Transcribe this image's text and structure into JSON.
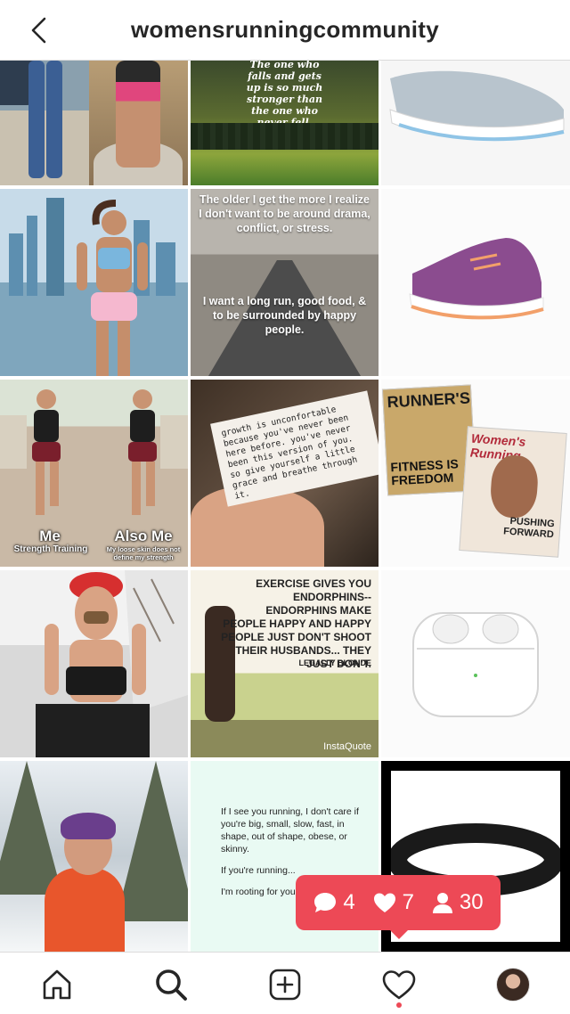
{
  "header": {
    "title": "womensrunningcommunity",
    "back_icon": "chevron-left-icon"
  },
  "tiles": {
    "quote_fall": "The one who falls and gets up is so much stronger than the one who never fell.",
    "quote_drama_top": "The older I get the more I realize I don't want to be around drama, conflict, or stress.",
    "quote_drama_bottom": "I want a long run, good food, & to be surrounded by happy people.",
    "meme_left": "Me",
    "meme_left_sub": "Strength Training",
    "meme_right": "Also Me",
    "meme_right_sub": "My loose skin does not define my strength",
    "paper_note": "growth is unconfortable because you've never been here before. you've never been this version of you. so give yourself a little grace and breathe through it.",
    "magazine_title": "RUNNER'S",
    "magazine_cover_line": "FITNESS IS FREEDOM",
    "magazine2_title": "Women's Running",
    "magazine2_cover_line": "PUSHING FORWARD",
    "quote_endorphins": "EXERCISE GIVES YOU ENDORPHINS-- ENDORPHINS MAKE PEOPLE HAPPY AND HAPPY PEOPLE JUST DON'T SHOOT THEIR HUSBANDS... THEY JUST DON'T.",
    "quote_endorphins_source": "LEGALLY BLONDE",
    "quote_brand": "InstaQuote",
    "note_lines": [
      "If I see you running, I don't care if you're big, small, slow, fast, in shape, out of shape, obese, or skinny.",
      "If you're running...",
      "I'm rooting for you."
    ]
  },
  "notifications": {
    "comments": "4",
    "likes": "7",
    "followers": "30",
    "color": "#ed4956"
  },
  "bottom_nav": {
    "items": [
      "home-icon",
      "search-icon",
      "add-post-icon",
      "activity-heart-icon",
      "profile-avatar"
    ],
    "active_dot_color": "#ed4956"
  }
}
